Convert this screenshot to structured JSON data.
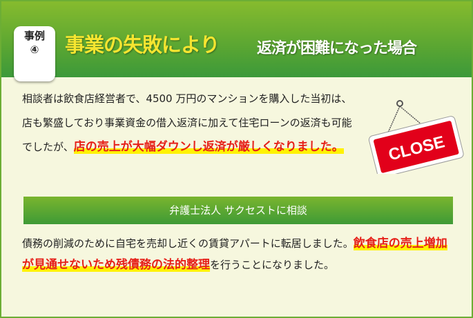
{
  "header": {
    "badge_line1": "事例",
    "badge_line2": "④",
    "title_main": "事業の失敗により",
    "title_sub": "返済が困難になった場合"
  },
  "case": {
    "text_before": "相談者は飲食店経営者で、4500 万円のマンションを購入した当初は、店も繁盛しており事業資金の借入返済に加えて住宅ローンの返済も可能でしたが、",
    "text_highlight": "店の売上が大幅ダウンし返済が厳しくなりました。",
    "sign_text": "CLOSE"
  },
  "banner": {
    "label": "弁護士法人 サクセストに相談"
  },
  "result": {
    "text_before": "債務の削減のために自宅を売却し近くの賃貸アパートに転居しました。",
    "text_highlight": "飲食店の売上増加が見通せないため残債務の法的整理",
    "text_after": "を行うことになりました。"
  },
  "colors": {
    "green": "#5aa632",
    "highlight_red": "#e62019",
    "highlight_yellow": "#fff200",
    "title_yellow": "#f6e530"
  }
}
